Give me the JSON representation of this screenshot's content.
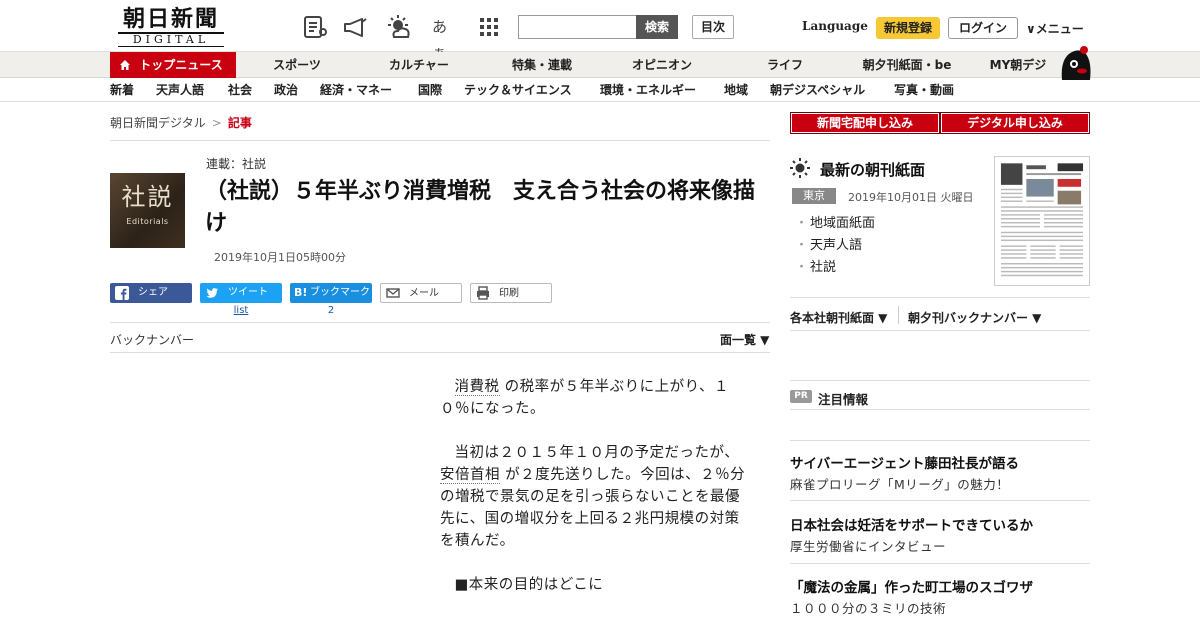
{
  "header": {
    "logo_main": "朝日新聞",
    "logo_sub": "DIGITAL",
    "icon_names": [
      "newspaper-icon",
      "megaphone-icon",
      "weather-icon",
      "font-size-icon",
      "grid-icon"
    ],
    "font_icon_label": "あぁ",
    "search_placeholder": "",
    "search_button": "検索",
    "index_button": "目次",
    "language": "Language",
    "register": "新規登録",
    "login": "ログイン",
    "menu": "∨メニュー"
  },
  "nav1": {
    "items": [
      "トップニュース",
      "スポーツ",
      "カルチャー",
      "特集・連載",
      "オピニオン",
      "ライフ",
      "朝夕刊紙面・be",
      "MY朝デジ"
    ],
    "active_index": 0
  },
  "nav2": {
    "items": [
      "新着",
      "天声人語",
      "社会",
      "政治",
      "経済・マネー",
      "国際",
      "テック＆サイエンス",
      "環境・エネルギー",
      "地域",
      "朝デジスペシャル",
      "写真・動画"
    ]
  },
  "breadcrumb": {
    "home": "朝日新聞デジタル",
    "sep": ">",
    "current": "記事"
  },
  "article": {
    "thumb_kanji": "社説",
    "thumb_en": "Editorials",
    "series": "連載：社説",
    "title": "（社説）５年半ぶり消費増税　支え合う社会の将来像描け",
    "date": "2019年10月1日05時00分",
    "backnumber": "バックナンバー",
    "list_all": "面一覧 ▼",
    "p1_kw": "消費税",
    "p1_rest": " の税率が５年半ぶりに上がり、１０％になった。",
    "p2_a": "当初は２０１５年１０月の予定だったが、",
    "p2_kw": "安倍首相",
    "p2_b": " が２度先送りした。今回は、２％分の増税で景気の足を引っ張らないことを最優先に、国の増収分を上回る２兆円規模の対策を積んだ。",
    "p3": "■本来の目的はどこに"
  },
  "share": {
    "facebook": "シェア",
    "twitter": "ツイート",
    "hatena": "ブックマーク",
    "hatena_mark": "B!",
    "mail": "メール",
    "print": "印刷",
    "twitter_count": "list",
    "hatena_count": "2"
  },
  "sidebar": {
    "subscribe_paper": "新聞宅配申し込み",
    "subscribe_digital": "デジタル申し込み",
    "paper_heading": "最新の朝刊紙面",
    "region": "東京",
    "paper_date": "2019年10月01日 火曜日",
    "paper_links": [
      "地域面紙面",
      "天声人語",
      "社説"
    ],
    "dropdown1": "各本社朝刊紙面 ▼",
    "dropdown2": "朝夕刊バックナンバー ▼",
    "pr_badge": "PR",
    "pr_heading": "注目情報",
    "ads": [
      {
        "title": "サイバーエージェント藤田社長が語る",
        "sub": "麻雀プロリーグ「Mリーグ」の魅力！"
      },
      {
        "title": "日本社会は妊活をサポートできているか",
        "sub": "厚生労働省にインタビュー"
      },
      {
        "title": "「魔法の金属」作った町工場のスゴワザ",
        "sub": "１０００分の３ミリの技術"
      }
    ]
  },
  "colors": {
    "accent_red": "#c80010",
    "register_yellow": "#f6c836",
    "facebook": "#3b5998",
    "twitter": "#1da1f2",
    "hatena": "#1a8fe0"
  }
}
